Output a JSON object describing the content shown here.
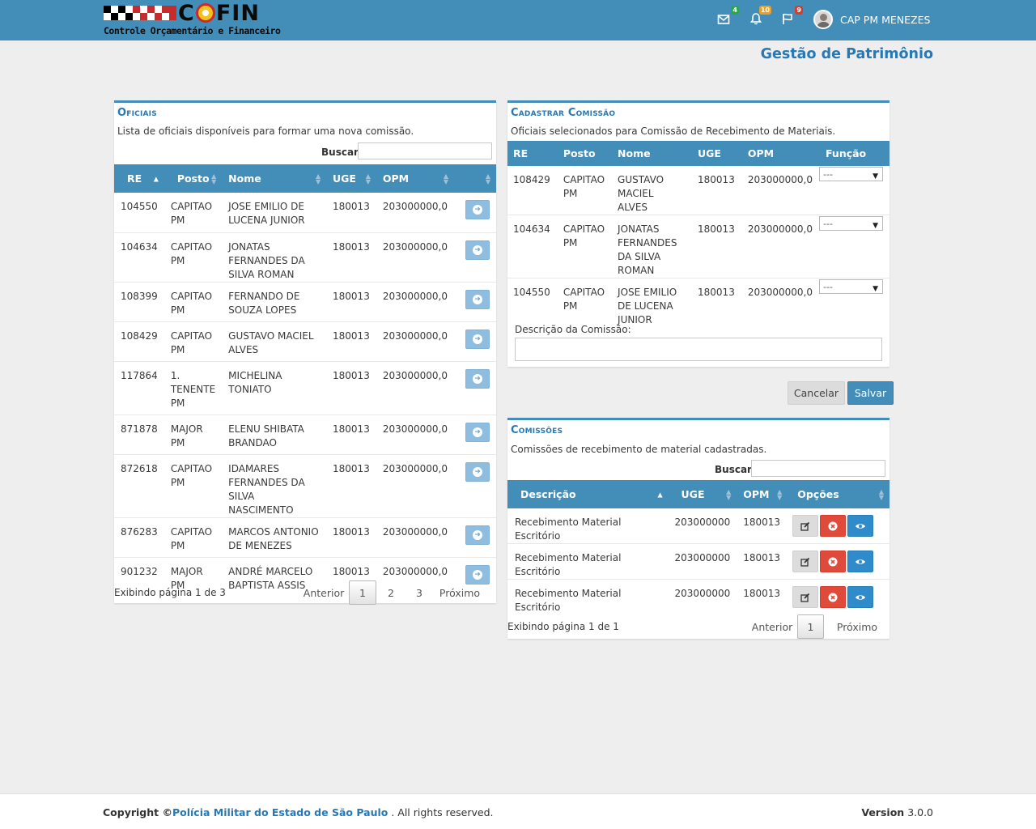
{
  "app": {
    "logo_text": "COFIN",
    "logo_subtitle": "Controle Orçamentário e Financeiro"
  },
  "navbar": {
    "messages_badge": "4",
    "notifications_badge": "10",
    "flags_badge": "9",
    "user_name": "CAP PM MENEZES",
    "badge_colors": {
      "messages": "#2ea44f",
      "notifications": "#f0a020",
      "flags": "#d23f30"
    }
  },
  "page": {
    "title": "Gestão de Patrimônio"
  },
  "oficiais": {
    "title": "Oficiais",
    "description": "Lista de oficiais disponíveis para formar uma nova comissão.",
    "search_label": "Buscar",
    "columns": [
      "RE",
      "Posto",
      "Nome",
      "UGE",
      "OPM"
    ],
    "rows": [
      {
        "re": "104550",
        "posto": "CAPITAO PM",
        "nome": "JOSE EMILIO DE LUCENA JUNIOR",
        "uge": "180013",
        "opm": "203000000,0"
      },
      {
        "re": "104634",
        "posto": "CAPITAO PM",
        "nome": "JONATAS FERNANDES DA SILVA ROMAN",
        "uge": "180013",
        "opm": "203000000,0"
      },
      {
        "re": "108399",
        "posto": "CAPITAO PM",
        "nome": "FERNANDO DE SOUZA LOPES",
        "uge": "180013",
        "opm": "203000000,0"
      },
      {
        "re": "108429",
        "posto": "CAPITAO PM",
        "nome": "GUSTAVO MACIEL ALVES",
        "uge": "180013",
        "opm": "203000000,0"
      },
      {
        "re": "117864",
        "posto": "1. TENENTE PM",
        "nome": "MICHELINA TONIATO",
        "uge": "180013",
        "opm": "203000000,0"
      },
      {
        "re": "871878",
        "posto": "MAJOR PM",
        "nome": "ELENU SHIBATA BRANDAO",
        "uge": "180013",
        "opm": "203000000,0"
      },
      {
        "re": "872618",
        "posto": "CAPITAO PM",
        "nome": "IDAMARES FERNANDES DA SILVA NASCIMENTO",
        "uge": "180013",
        "opm": "203000000,0"
      },
      {
        "re": "876283",
        "posto": "CAPITAO PM",
        "nome": "MARCOS ANTONIO DE MENEZES",
        "uge": "180013",
        "opm": "203000000,0"
      },
      {
        "re": "901232",
        "posto": "MAJOR PM",
        "nome": "ANDRÉ MARCELO BAPTISTA ASSIS",
        "uge": "180013",
        "opm": "203000000,0"
      }
    ],
    "pager_info": "Exibindo página 1 de 3",
    "pager": {
      "prev": "Anterior",
      "pages": [
        "1",
        "2",
        "3"
      ],
      "next": "Próximo",
      "current": "1"
    }
  },
  "cadastrar": {
    "title": "Cadastrar Comissão",
    "description": "Oficiais selecionados para Comissão de Recebimento de Materiais.",
    "columns": [
      "RE",
      "Posto",
      "Nome",
      "UGE",
      "OPM",
      "Função"
    ],
    "rows": [
      {
        "re": "108429",
        "posto": "CAPITAO PM",
        "nome": "GUSTAVO MACIEL ALVES",
        "uge": "180013",
        "opm": "203000000,0",
        "funcao": "---"
      },
      {
        "re": "104634",
        "posto": "CAPITAO PM",
        "nome": "JONATAS FERNANDES DA SILVA ROMAN",
        "uge": "180013",
        "opm": "203000000,0",
        "funcao": "---"
      },
      {
        "re": "104550",
        "posto": "CAPITAO PM",
        "nome": "JOSE EMILIO DE LUCENA JUNIOR",
        "uge": "180013",
        "opm": "203000000,0",
        "funcao": "---"
      }
    ],
    "desc_label": "Descrição da Comissão:",
    "desc_value": "",
    "cancel_label": "Cancelar",
    "save_label": "Salvar"
  },
  "comissoes": {
    "title": "Comissões",
    "description": "Comissões de recebimento de material cadastradas.",
    "search_label": "Buscar",
    "columns": [
      "Descrição",
      "UGE",
      "OPM",
      "Opções"
    ],
    "rows": [
      {
        "descricao": "Recebimento Material Escritório",
        "uge": "203000000",
        "opm": "180013"
      },
      {
        "descricao": "Recebimento Material Escritório",
        "uge": "203000000",
        "opm": "180013"
      },
      {
        "descricao": "Recebimento Material Escritório",
        "uge": "203000000",
        "opm": "180013"
      }
    ],
    "pager_info": "Exibindo página 1 de 1",
    "pager": {
      "prev": "Anterior",
      "pages": [
        "1"
      ],
      "next": "Próximo",
      "current": "1"
    }
  },
  "footer": {
    "copyright_label": "Copyright ©",
    "org": "Polícia Militar do Estado de São Paulo",
    "rights": " . All rights reserved.",
    "version_label": "Version",
    "version": "3.0.0"
  }
}
